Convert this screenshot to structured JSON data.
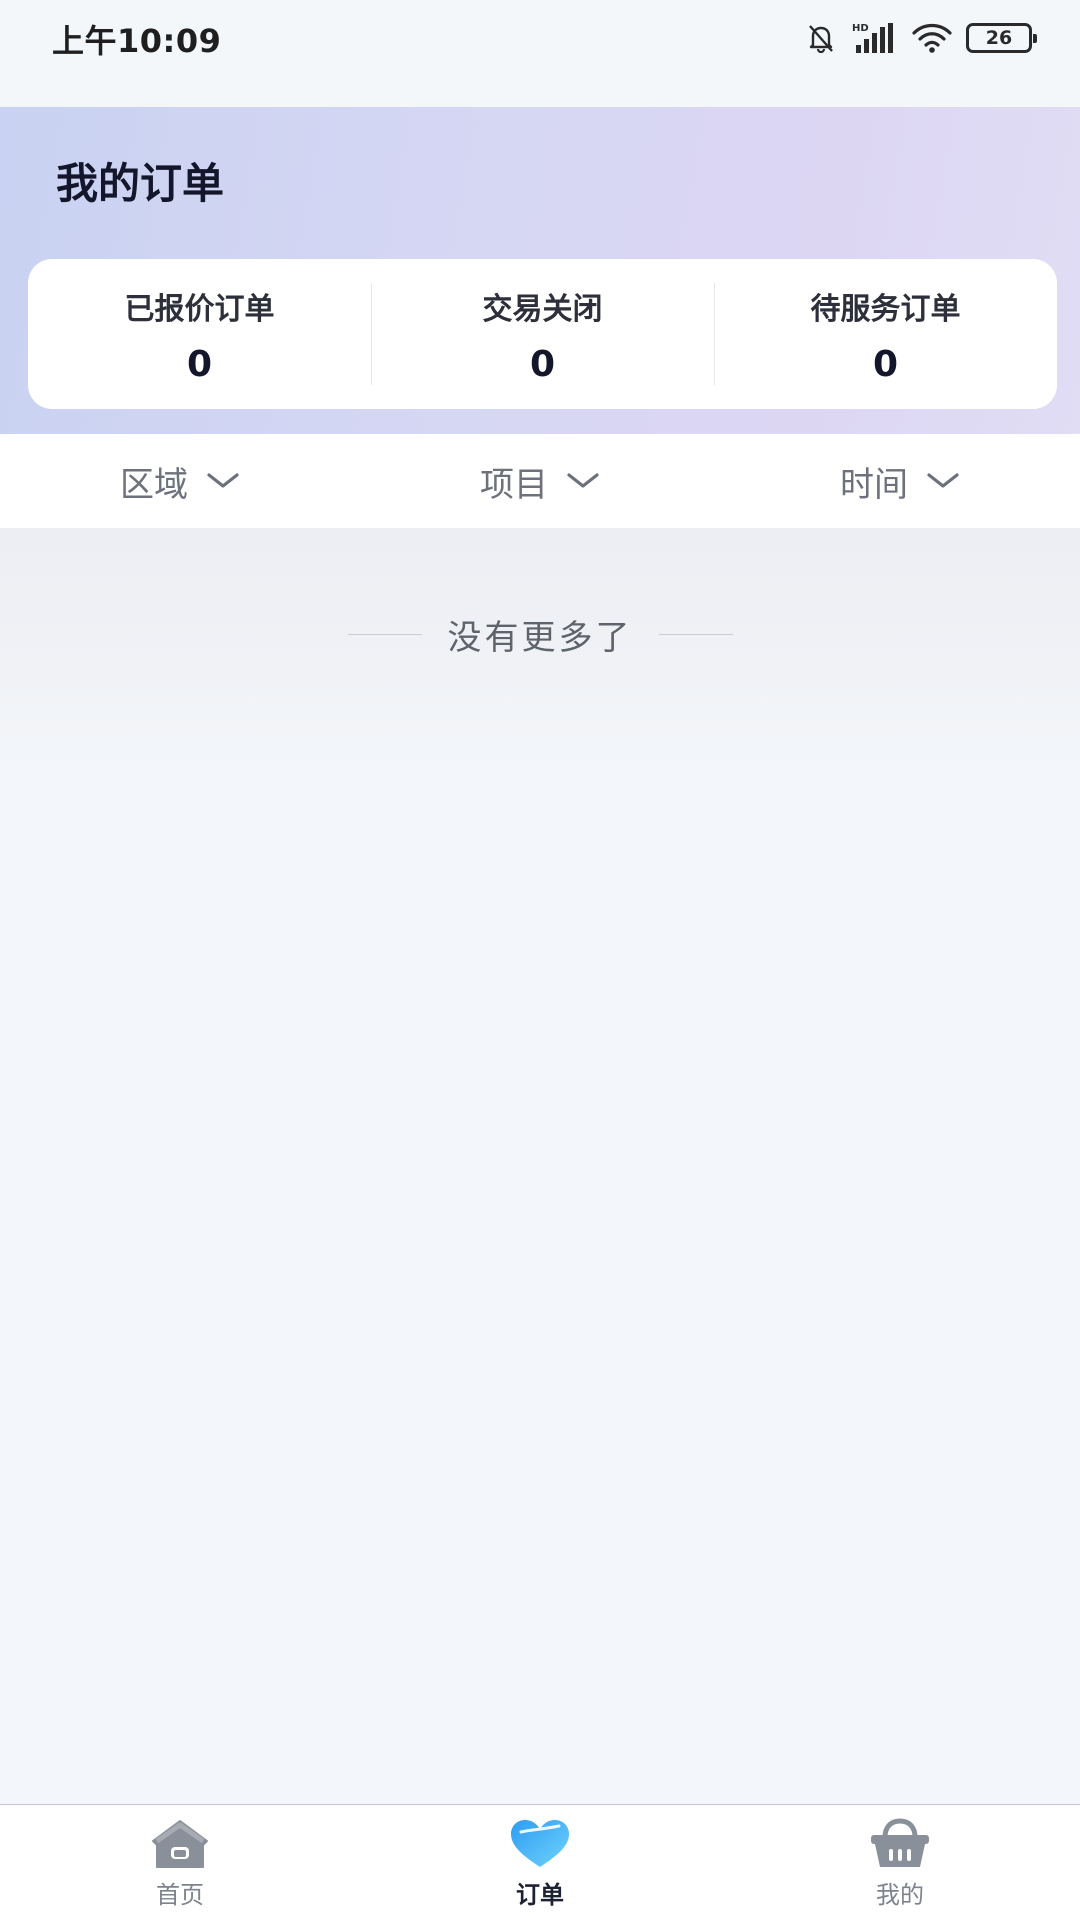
{
  "status_bar": {
    "time": "上午10:09",
    "battery": "26",
    "icons": [
      "bell-muted-icon",
      "hd-signal-icon",
      "wifi-icon",
      "battery-icon"
    ]
  },
  "header": {
    "title": "我的订单"
  },
  "summary": [
    {
      "label": "已报价订单",
      "count": "0"
    },
    {
      "label": "交易关闭",
      "count": "0"
    },
    {
      "label": "待服务订单",
      "count": "0"
    }
  ],
  "filters": [
    {
      "label": "区域",
      "icon": "chevron-down-icon"
    },
    {
      "label": "项目",
      "icon": "chevron-down-icon"
    },
    {
      "label": "时间",
      "icon": "chevron-down-icon"
    }
  ],
  "content": {
    "empty_text": "没有更多了"
  },
  "bottom_nav": {
    "items": [
      {
        "label": "首页",
        "icon": "home-icon",
        "active": false
      },
      {
        "label": "订单",
        "icon": "heart-icon",
        "active": true
      },
      {
        "label": "我的",
        "icon": "basket-icon",
        "active": false
      }
    ]
  },
  "colors": {
    "active_accent": "#3fa9f5",
    "inactive_icon": "#8a9099",
    "title_text": "#14172b"
  }
}
